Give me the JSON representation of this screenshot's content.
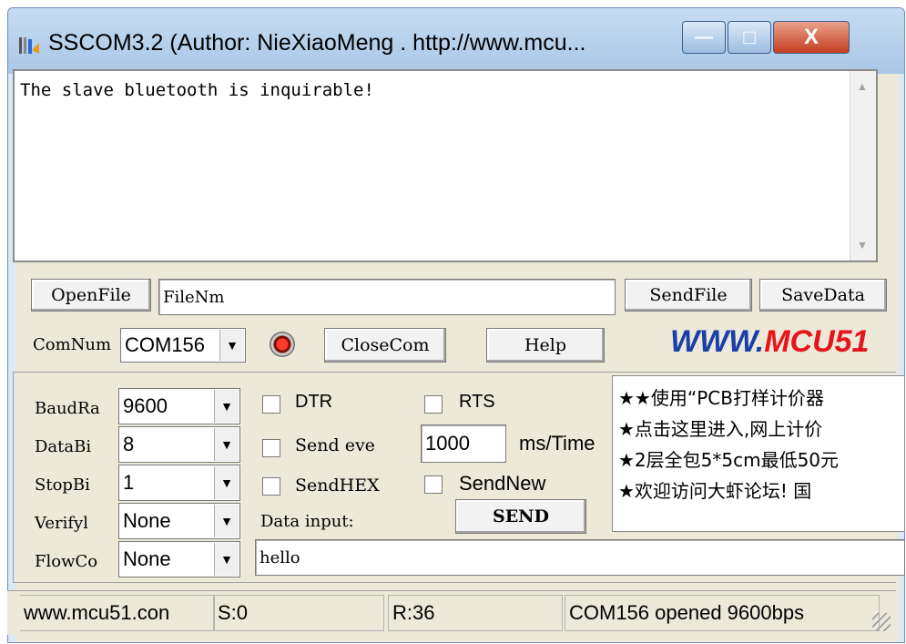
{
  "window": {
    "title": "SSCOM3.2 (Author: NieXiaoMeng .  http://www.mcu...",
    "controls": {
      "minimize": "—",
      "maximize": "□",
      "close": "X"
    }
  },
  "receive": {
    "text": "The slave bluetooth is inquirable!"
  },
  "file_row": {
    "open_file": "OpenFile",
    "filename": "FileNm",
    "send_file": "SendFile",
    "save_data": "SaveData"
  },
  "com_row": {
    "comnum_label": "ComNum",
    "comnum_value": "COM156",
    "close_com": "CloseCom",
    "help": "Help",
    "banner_left": "WWW.",
    "banner_right": "MCU51",
    "banner_colors": {
      "left": "#1a3fa8",
      "right": "#e8141c"
    }
  },
  "settings": {
    "baud_label": "BaudRa",
    "baud_value": "9600",
    "databits_label": "DataBi",
    "databits_value": "8",
    "stopbits_label": "StopBi",
    "stopbits_value": "1",
    "verify_label": "Verifyl",
    "verify_value": "None",
    "flow_label": "FlowCo",
    "flow_value": "None"
  },
  "options": {
    "dtr": "DTR",
    "rts": "RTS",
    "send_every": "Send eve",
    "interval_value": "1000",
    "interval_unit": "ms/Time",
    "send_hex": "SendHEX",
    "send_new": "SendNew",
    "data_input_label": "Data input:",
    "send_button": "SEND",
    "data_input_value": "hello"
  },
  "ads": [
    "★★使用“PCB打样计价器",
    "★点击这里进入,网上计价",
    "★2层全包5*5cm最低50元",
    "★欢迎访问大虾论坛! 国"
  ],
  "status": {
    "url": "www.mcu51.con",
    "sent": "S:0",
    "received": "R:36",
    "port_state": "COM156 opened 9600bps"
  },
  "icons": {
    "app": "sscom-app-icon",
    "led": "port-status-led-red",
    "led_color": "#e8141c"
  }
}
